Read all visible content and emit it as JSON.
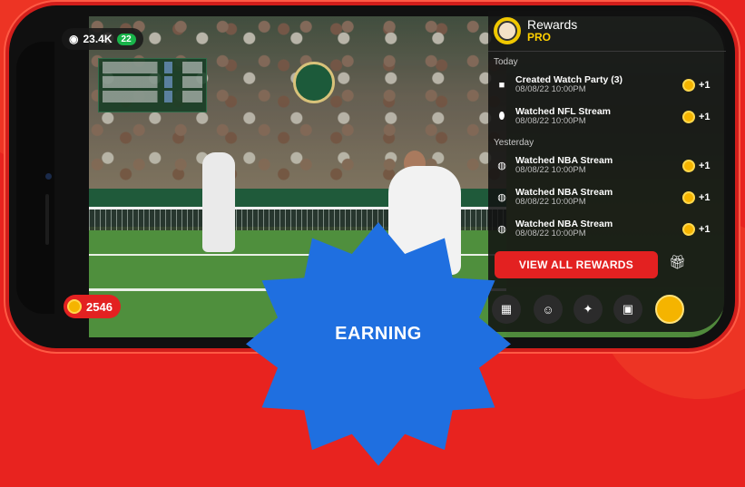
{
  "stream": {
    "viewer_count": "23.4K",
    "live_badge": "22"
  },
  "rewards": {
    "title": "Rewards",
    "tier": "PRO",
    "sections": [
      {
        "label": "Today",
        "items": [
          {
            "icon": "video-camera-icon",
            "label": "Created Watch Party (3)",
            "time": "08/08/22 10:00PM",
            "points": "+1"
          },
          {
            "icon": "football-icon",
            "label": "Watched NFL Stream",
            "time": "08/08/22 10:00PM",
            "points": "+1"
          }
        ]
      },
      {
        "label": "Yesterday",
        "items": [
          {
            "icon": "basketball-icon",
            "label": "Watched NBA Stream",
            "time": "08/08/22 10:00PM",
            "points": "+1"
          },
          {
            "icon": "basketball-icon",
            "label": "Watched NBA Stream",
            "time": "08/08/22 10:00PM",
            "points": "+1"
          },
          {
            "icon": "basketball-icon",
            "label": "Watched NBA Stream",
            "time": "08/08/22 10:00PM",
            "points": "+1"
          }
        ]
      }
    ],
    "view_all_label": "VIEW ALL REWARDS"
  },
  "balance": "2546",
  "banner": "EARNING",
  "colors": {
    "brand_red": "#e32121",
    "pro_yellow": "#ffd000",
    "coin_gold": "#f5b400",
    "banner_blue": "#1f6fe0",
    "live_green": "#19b34a"
  },
  "bottom_bar_icons": [
    "layout-icon",
    "friends-icon",
    "sports-icon",
    "gamepad-icon",
    "rewards-coin-icon"
  ]
}
